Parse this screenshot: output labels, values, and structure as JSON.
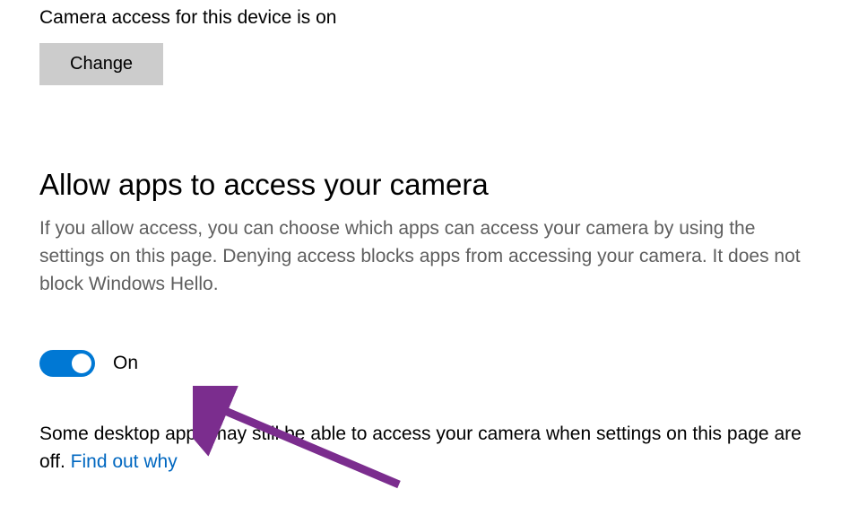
{
  "device_access": {
    "status_text": "Camera access for this device is on",
    "change_button_label": "Change"
  },
  "allow_apps": {
    "heading": "Allow apps to access your camera",
    "description": "If you allow access, you can choose which apps can access your camera by using the settings on this page. Denying access blocks apps from accessing your camera. It does not block Windows Hello.",
    "toggle_state": "On"
  },
  "footer": {
    "text_part1": "Some desktop apps may still be able to access your camera when settings on this page are off. ",
    "link_text": "Find out why"
  },
  "colors": {
    "accent": "#0078d4",
    "button_bg": "#cccccc",
    "description_text": "#5e5e5e",
    "link": "#0067c0",
    "annotation": "#7b2d8e"
  }
}
